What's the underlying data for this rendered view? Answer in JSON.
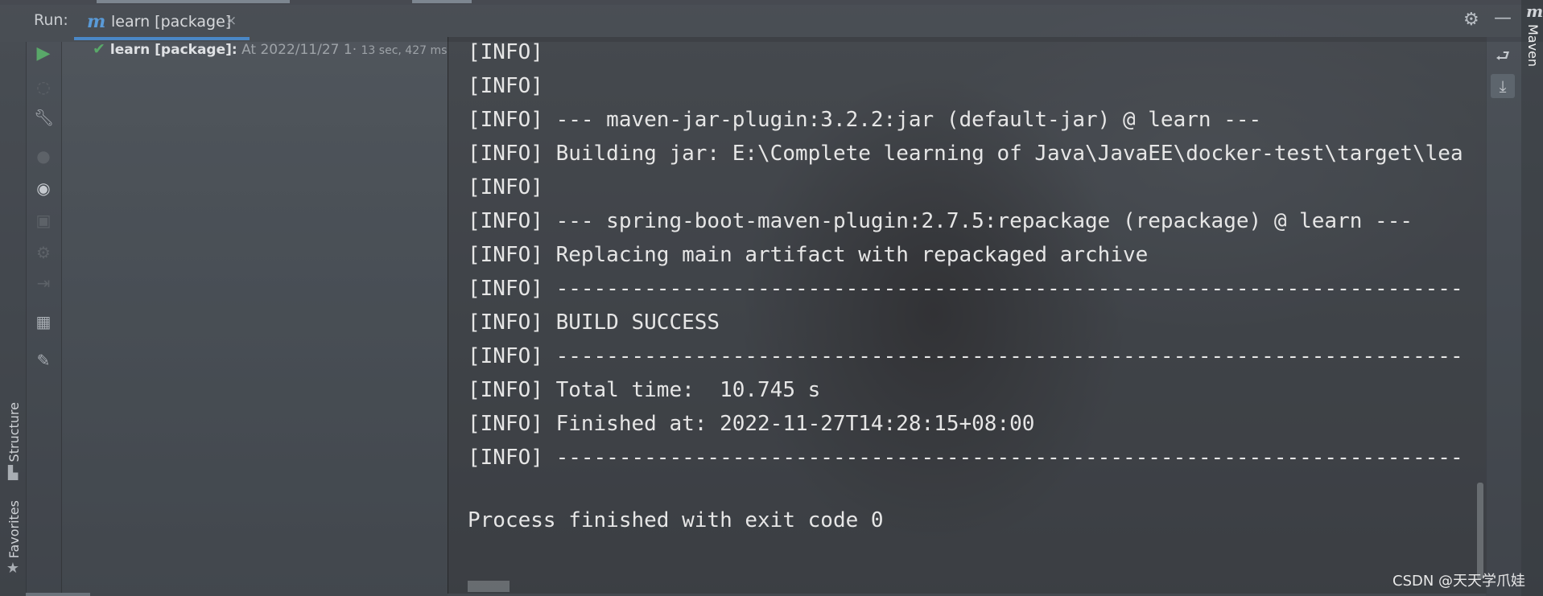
{
  "run_panel": {
    "label": "Run:",
    "tab": {
      "icon": "m",
      "title": "learn [package]",
      "close": "×"
    }
  },
  "tree": {
    "name": "learn [package]:",
    "at": "At 2022/11/27 1·",
    "duration": "13 sec, 427 ms"
  },
  "console": {
    "lines": [
      "[INFO]",
      "[INFO]",
      "[INFO] --- maven-jar-plugin:3.2.2:jar (default-jar) @ learn ---",
      "[INFO] Building jar: E:\\Complete learning of Java\\JavaEE\\docker-test\\target\\lea",
      "[INFO]",
      "[INFO] --- spring-boot-maven-plugin:2.7.5:repackage (repackage) @ learn ---",
      "[INFO] Replacing main artifact with repackaged archive",
      "[INFO] ------------------------------------------------------------------------",
      "[INFO] BUILD SUCCESS",
      "[INFO] ------------------------------------------------------------------------",
      "[INFO] Total time:  10.745 s",
      "[INFO] Finished at: 2022-11-27T14:28:15+08:00",
      "[INFO] ------------------------------------------------------------------------"
    ],
    "process": "Process finished with exit code 0"
  },
  "side_tabs": {
    "structure": "Structure",
    "favorites": "Favorites"
  },
  "maven_panel": {
    "icon": "m",
    "label": "Maven"
  },
  "icons": {
    "toolbar": [
      "run-icon",
      "rerun-icon",
      "wrench-icon",
      "stop-icon",
      "eye-icon",
      "camera-icon",
      "gear-small-icon",
      "exit-icon",
      "layout-icon",
      "pin-icon"
    ],
    "accent": "#4a88c7",
    "success": "#59a869"
  },
  "watermark": "CSDN @天天学爪娃"
}
